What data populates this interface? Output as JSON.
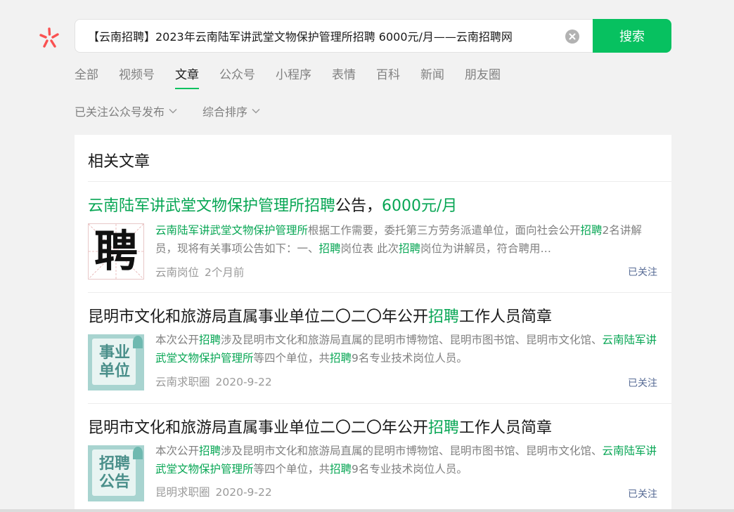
{
  "search": {
    "query": "【云南招聘】2023年云南陆军讲武堂文物保护管理所招聘 6000元/月——云南招聘网",
    "button_label": "搜索"
  },
  "tabs": [
    {
      "label": "全部"
    },
    {
      "label": "视频号"
    },
    {
      "label": "文章",
      "active": true
    },
    {
      "label": "公众号"
    },
    {
      "label": "小程序"
    },
    {
      "label": "表情"
    },
    {
      "label": "百科"
    },
    {
      "label": "新闻"
    },
    {
      "label": "朋友圈"
    }
  ],
  "filters": [
    {
      "label": "已关注公众号发布"
    },
    {
      "label": "综合排序"
    }
  ],
  "section_title": "相关文章",
  "articles": [
    {
      "title_parts": [
        {
          "text": "云南陆军讲武堂文物保护管理所招聘",
          "hl": true
        },
        {
          "text": "公告，",
          "hl": false
        },
        {
          "text": "6000元/月",
          "hl": true
        }
      ],
      "thumb_text": "聘",
      "snippet_parts": [
        {
          "text": "云南陆军讲武堂文物保护管理所",
          "hl": true
        },
        {
          "text": "根据工作需要，委托第三方劳务派遣单位，面向社会公开",
          "hl": false
        },
        {
          "text": "招聘",
          "hl": true
        },
        {
          "text": "2名讲解员，现将有关事项公告如下：一、",
          "hl": false
        },
        {
          "text": "招聘",
          "hl": true
        },
        {
          "text": "岗位表 此次",
          "hl": false
        },
        {
          "text": "招聘",
          "hl": true
        },
        {
          "text": "岗位为讲解员，符合聘用…",
          "hl": false
        }
      ],
      "source": "云南岗位",
      "time": "2个月前",
      "followed_label": "已关注"
    },
    {
      "title_parts": [
        {
          "text": "昆明市文化和旅游局直属事业单位二〇二〇年公开",
          "hl": false
        },
        {
          "text": "招聘",
          "hl": true
        },
        {
          "text": "工作人员简章",
          "hl": false
        }
      ],
      "thumb_text": [
        "事业",
        "单位"
      ],
      "snippet_parts": [
        {
          "text": "本次公开",
          "hl": false
        },
        {
          "text": "招聘",
          "hl": true
        },
        {
          "text": "涉及昆明市文化和旅游局直属的昆明市博物馆、昆明市图书馆、昆明市文化馆、",
          "hl": false
        },
        {
          "text": "云南陆军讲武堂文物保护管理所",
          "hl": true
        },
        {
          "text": "等四个单位，共",
          "hl": false
        },
        {
          "text": "招聘",
          "hl": true
        },
        {
          "text": "9名专业技术岗位人员。",
          "hl": false
        }
      ],
      "source": "云南求职圈",
      "time": "2020-9-22",
      "followed_label": "已关注"
    },
    {
      "title_parts": [
        {
          "text": "昆明市文化和旅游局直属事业单位二〇二〇年公开",
          "hl": false
        },
        {
          "text": "招聘",
          "hl": true
        },
        {
          "text": "工作人员简章",
          "hl": false
        }
      ],
      "thumb_text": [
        "招聘",
        "公告"
      ],
      "snippet_parts": [
        {
          "text": "本次公开",
          "hl": false
        },
        {
          "text": "招聘",
          "hl": true
        },
        {
          "text": "涉及昆明市文化和旅游局直属的昆明市博物馆、昆明市图书馆、昆明市文化馆、",
          "hl": false
        },
        {
          "text": "云南陆军讲武堂文物保护管理所",
          "hl": true
        },
        {
          "text": "等四个单位，共",
          "hl": false
        },
        {
          "text": "招聘",
          "hl": true
        },
        {
          "text": "9名专业技术岗位人员。",
          "hl": false
        }
      ],
      "source": "昆明求职圈",
      "time": "2020-9-22",
      "followed_label": "已关注"
    }
  ],
  "colors": {
    "accent": "#07c160",
    "highlight": "#07a654",
    "link": "#576b95",
    "logo": "#fa5151"
  }
}
